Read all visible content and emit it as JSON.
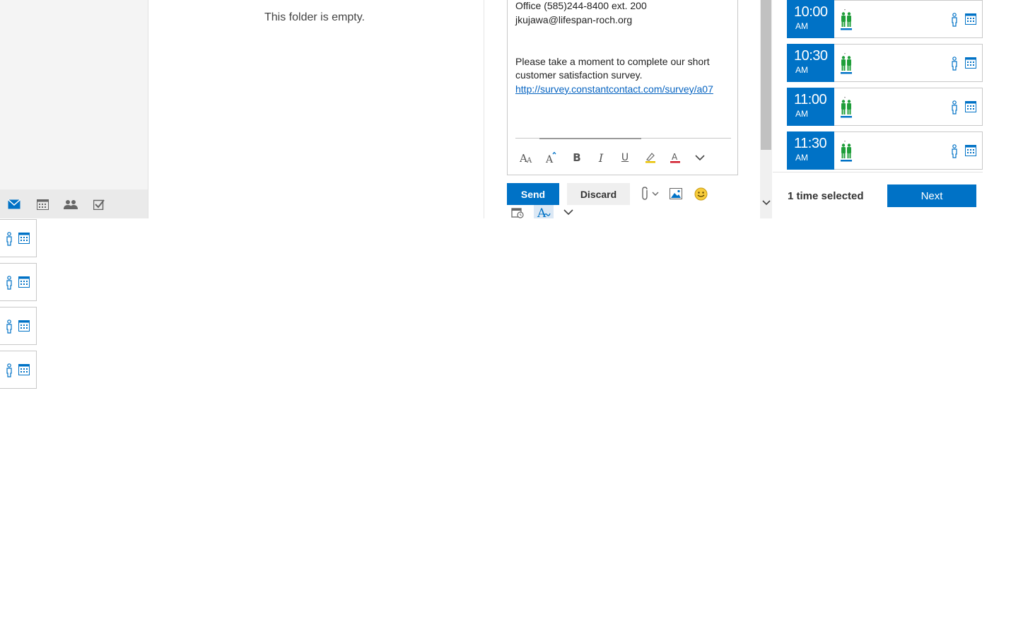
{
  "message_list": {
    "empty_text": "This folder is empty."
  },
  "nav": {
    "modules": [
      {
        "name": "mail-icon",
        "active": true
      },
      {
        "name": "calendar-icon",
        "active": false
      },
      {
        "name": "people-icon",
        "active": false
      },
      {
        "name": "tasks-icon",
        "active": false
      }
    ]
  },
  "compose": {
    "body_lines": [
      "Office (585)244-8400 ext. 200",
      "jkujawa@lifespan-roch.org",
      "Please take a moment to complete our short",
      "customer satisfaction survey."
    ],
    "survey_link": "http://survey.constantcontact.com/survey/a07",
    "send_label": "Send",
    "discard_label": "Discard"
  },
  "timepicker": {
    "slots": [
      {
        "time": "10:00",
        "ampm": "AM"
      },
      {
        "time": "10:30",
        "ampm": "AM"
      },
      {
        "time": "11:00",
        "ampm": "AM"
      },
      {
        "time": "11:30",
        "ampm": "AM"
      }
    ],
    "selected_text": "1 time selected",
    "next_label": "Next"
  },
  "colors": {
    "accent": "#0072c6",
    "attendee_green": "#1f9e3a"
  }
}
